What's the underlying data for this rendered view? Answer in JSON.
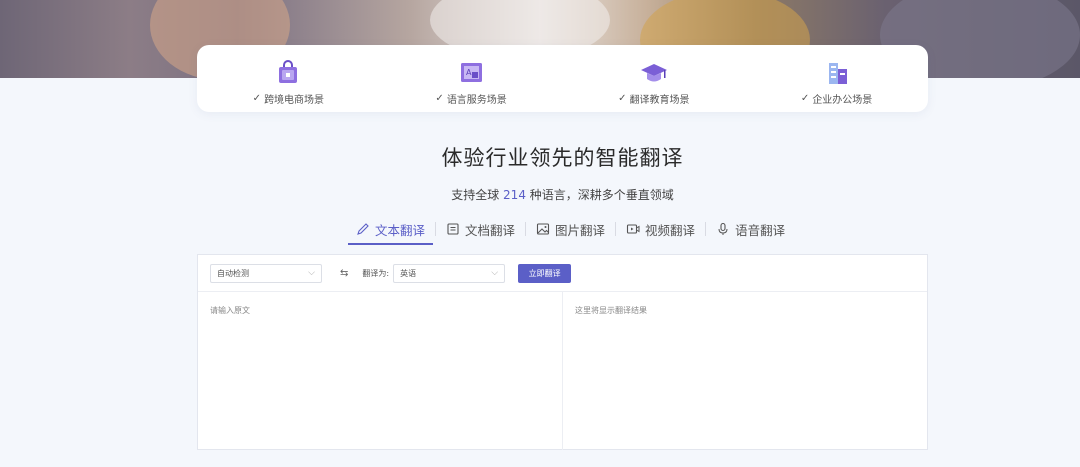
{
  "scenarios": [
    {
      "icon": "shopping-bag-icon",
      "label": "跨境电商场景"
    },
    {
      "icon": "language-service-icon",
      "label": "语言服务场景"
    },
    {
      "icon": "graduation-cap-icon",
      "label": "翻译教育场景"
    },
    {
      "icon": "office-building-icon",
      "label": "企业办公场景"
    }
  ],
  "check_mark": "✓",
  "heading": {
    "title": "体验行业领先的智能翻译",
    "subtitle_pre": "支持全球 ",
    "subtitle_num": "214",
    "subtitle_post": " 种语言，深耕多个垂直领域"
  },
  "tabs": [
    {
      "icon": "pencil-icon",
      "label": "文本翻译",
      "active": true
    },
    {
      "icon": "document-icon",
      "label": "文档翻译",
      "active": false
    },
    {
      "icon": "image-icon",
      "label": "图片翻译",
      "active": false
    },
    {
      "icon": "video-icon",
      "label": "视频翻译",
      "active": false
    },
    {
      "icon": "microphone-icon",
      "label": "语音翻译",
      "active": false
    }
  ],
  "translator": {
    "source_lang": "自动检测",
    "swap_glyph": "⇆",
    "target_label": "翻译为:",
    "target_lang": "英语",
    "translate_button": "立即翻译",
    "input_placeholder": "请输入原文",
    "output_placeholder": "这里将显示翻译结果"
  },
  "colors": {
    "accent": "#5b5fc7",
    "icon_purple": "#7b5fd6"
  }
}
